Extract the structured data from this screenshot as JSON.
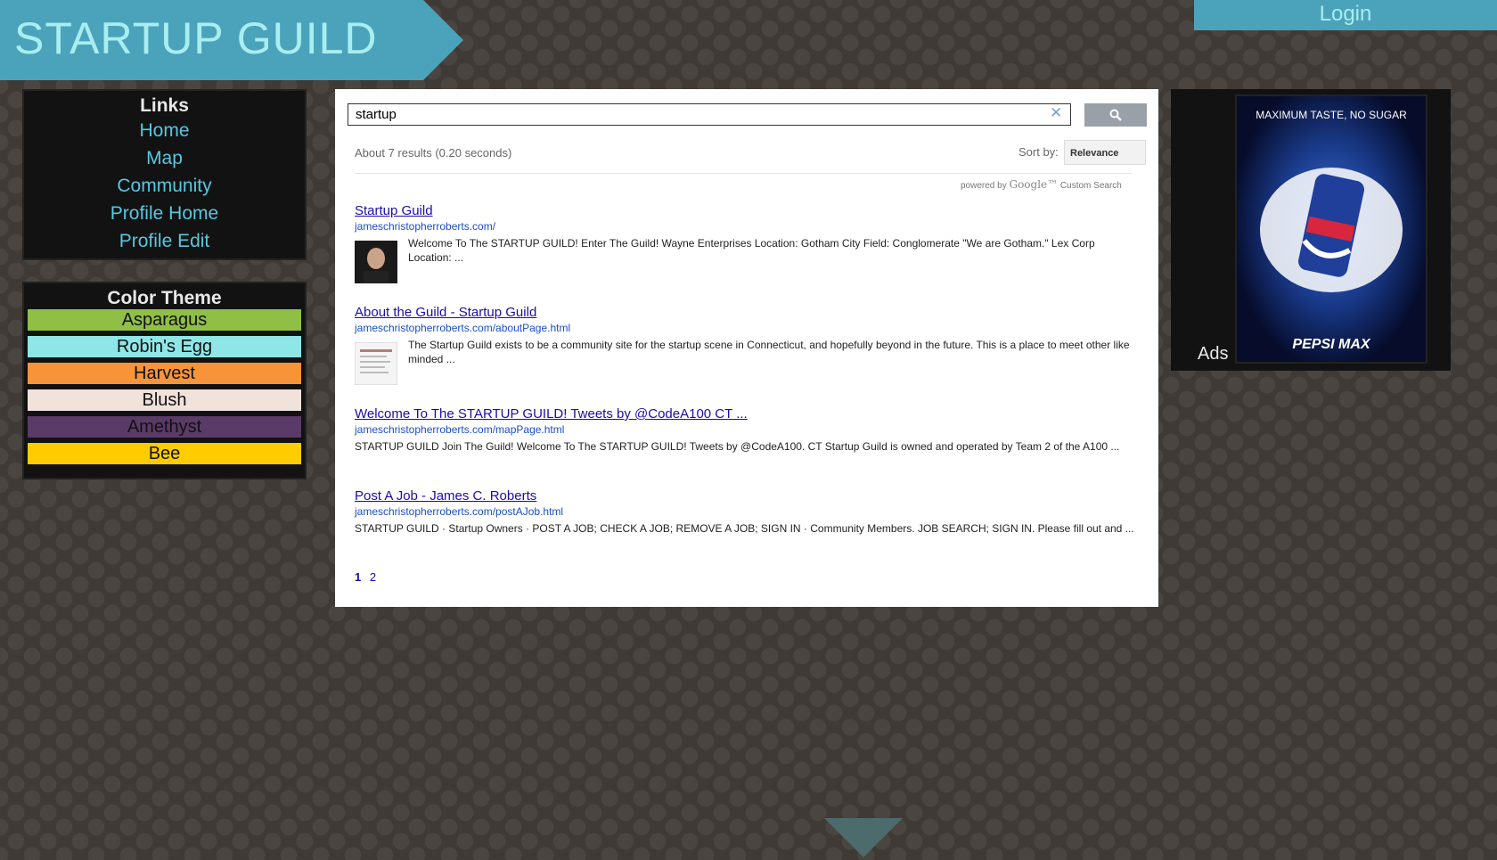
{
  "header": {
    "title": "STARTUP GUILD",
    "login_label": "Login"
  },
  "links": {
    "heading": "Links",
    "items": [
      "Home",
      "Map",
      "Community",
      "Profile Home",
      "Profile Edit"
    ]
  },
  "theme": {
    "heading": "Color Theme",
    "swatches": [
      {
        "label": "Asparagus",
        "color": "#8fbf45"
      },
      {
        "label": "Robin's Egg",
        "color": "#8fe6e6"
      },
      {
        "label": "Harvest",
        "color": "#f7943a"
      },
      {
        "label": "Blush",
        "color": "#f2e2dc"
      },
      {
        "label": "Amethyst",
        "color": "#5a3a66"
      },
      {
        "label": "Bee",
        "color": "#ffcc00"
      }
    ]
  },
  "search": {
    "query": "startup",
    "stats": "About 7 results (0.20 seconds)",
    "sort_label": "Sort by:",
    "sort_value": "Relevance",
    "powered_prefix": "powered by",
    "powered_brand": "Google™",
    "powered_suffix": "Custom Search"
  },
  "results": [
    {
      "title": "Startup Guild",
      "url": "jameschristopherroberts.com/",
      "snippet": "Welcome To The STARTUP GUILD! Enter The Guild! Wayne Enterprises Location: Gotham City Field: Conglomerate \"We are Gotham.\" Lex Corp Location:  ..."
    },
    {
      "title": "About the Guild - Startup Guild",
      "url": "jameschristopherroberts.com/aboutPage.html",
      "snippet": "The Startup Guild exists to be a community site for the startup scene in Connecticut, and hopefully beyond in the future. This is a place to meet other like minded ..."
    },
    {
      "title": "Welcome To The STARTUP GUILD! Tweets by @CodeA100 CT ...",
      "url": "jameschristopherroberts.com/mapPage.html",
      "snippet": "STARTUP GUILD Join The Guild! Welcome To The STARTUP GUILD! Tweets by @CodeA100. CT Startup Guild is owned and operated by Team 2 of the A100 ..."
    },
    {
      "title": "Post A Job - James C. Roberts",
      "url": "jameschristopherroberts.com/postAJob.html",
      "snippet": "STARTUP GUILD · Startup Owners · POST A JOB; CHECK A JOB; REMOVE A JOB; SIGN IN · Community Members. JOB SEARCH; SIGN IN. Please fill out and ..."
    }
  ],
  "pagination": [
    "1",
    "2"
  ],
  "ads": {
    "label": "Ads",
    "tagline": "MAXIMUM TASTE, NO SUGAR",
    "brand": "PEPSI MAX"
  }
}
